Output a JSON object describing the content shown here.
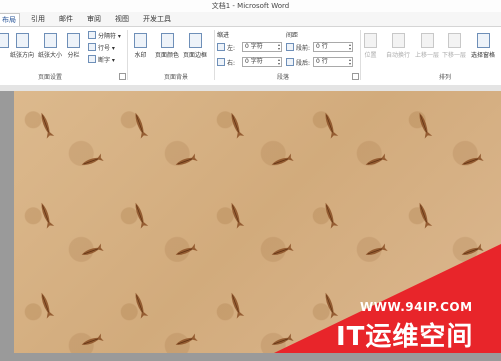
{
  "window": {
    "title": "文档1 - Microsoft Word"
  },
  "tabs": [
    {
      "label": "布局",
      "active": true
    },
    {
      "label": "引用",
      "active": false
    },
    {
      "label": "邮件",
      "active": false
    },
    {
      "label": "审阅",
      "active": false
    },
    {
      "label": "视图",
      "active": false
    },
    {
      "label": "开发工具",
      "active": false
    }
  ],
  "page_setup": {
    "group_label": "页面设置",
    "paper_direction": "纸张方向",
    "paper_size": "纸张大小",
    "columns": "分栏",
    "breaks": "分隔符",
    "line_numbers": "行号",
    "hyphenation": "断字"
  },
  "page_background": {
    "group_label": "页面背景",
    "watermark": "水印",
    "page_color": "页面颜色",
    "page_borders": "页面边框"
  },
  "paragraph": {
    "group_label": "段落",
    "indent_label": "缩进",
    "spacing_label": "间距",
    "indent_left_label": "左:",
    "indent_left_value": "0 字符",
    "indent_right_label": "右:",
    "indent_right_value": "0 字符",
    "spacing_before_label": "段前:",
    "spacing_before_value": "0 行",
    "spacing_after_label": "段后:",
    "spacing_after_value": "0 行"
  },
  "arrange": {
    "group_label": "排列",
    "position": "位置",
    "wrap_text": "自动换行",
    "bring_forward": "上移一层",
    "send_backward": "下移一层",
    "selection_pane": "选择窗格"
  },
  "watermark": {
    "url": "WWW.94IP.COM",
    "name": "IT运维空间",
    "color": "#e8252a"
  },
  "colors": {
    "accent": "#2b579a",
    "page_bg": "#d9b589"
  }
}
